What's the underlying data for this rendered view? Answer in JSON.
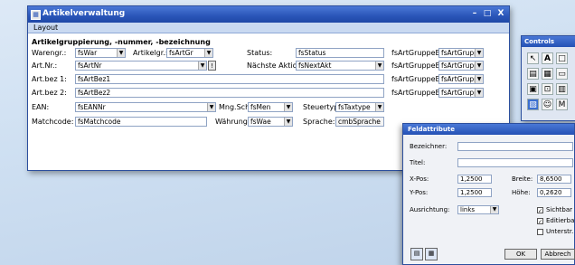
{
  "window": {
    "title": "Artikelverwaltung",
    "min": "–",
    "max": "□",
    "close": "X"
  },
  "menu": {
    "layout": "Layout"
  },
  "group_title": "Artikelgruppierung, -nummer, -bezeichnung",
  "rows": {
    "warengr_label": "Warengr.:",
    "warengr_value": "fsWar",
    "artikelgr_label": "Artikelgr.:",
    "artikelgr_value": "fsArtGr",
    "status_label": "Status:",
    "status_value": "fsStatus",
    "artnr_label": "Art.Nr.:",
    "artnr_value": "fsArtNr",
    "naechste_label": "Nächste Aktion:",
    "naechste_value": "fsNextAkt",
    "artbez1_label": "Art.bez 1:",
    "artbez1_value": "fsArtBez1",
    "artbez2_label": "Art.bez 2:",
    "artbez2_value": "fsArtBez2",
    "ean_label": "EAN:",
    "ean_value": "fsEANNr",
    "mngschl_label": "Mng.Schl.:",
    "mngschl_value": "fsMen",
    "steuertyp_label": "Steuertyp:",
    "steuertyp_value": "fsTaxtype",
    "matchcode_label": "Matchcode:",
    "matchcode_value": "fsMatchcode",
    "waehrung_label": "Währung:",
    "waehrung_value": "fsWae",
    "sprache_label": "Sprache:",
    "sprache_value": "cmbSprache",
    "artgruppe_label": "fsArtGruppeBe",
    "artgruppe_combo": "fsArtGruppe"
  },
  "palette": {
    "title": "Controls",
    "tools": [
      "↖",
      "A",
      "□",
      "▤",
      "▦",
      "▭",
      "▣",
      "⊡",
      "▥",
      "▧",
      "☺",
      "M"
    ]
  },
  "dialog": {
    "title": "Feldattribute",
    "bezeichner_label": "Bezeichner:",
    "titel_label": "Titel:",
    "xpos_label": "X-Pos:",
    "xpos_value": "1,2500",
    "breite_label": "Breite:",
    "breite_value": "8,6500",
    "ypos_label": "Y-Pos:",
    "ypos_value": "1,2500",
    "hoehe_label": "Höhe:",
    "hoehe_value": "0,2620",
    "ausrichtung_label": "Ausrichtung:",
    "ausrichtung_value": "links",
    "sichtbar_label": "Sichtbar",
    "editierbar_label": "Editierbar",
    "unterstr_label": "Unterstr.",
    "ok_label": "OK",
    "abbrechen_label": "Abbrech"
  }
}
